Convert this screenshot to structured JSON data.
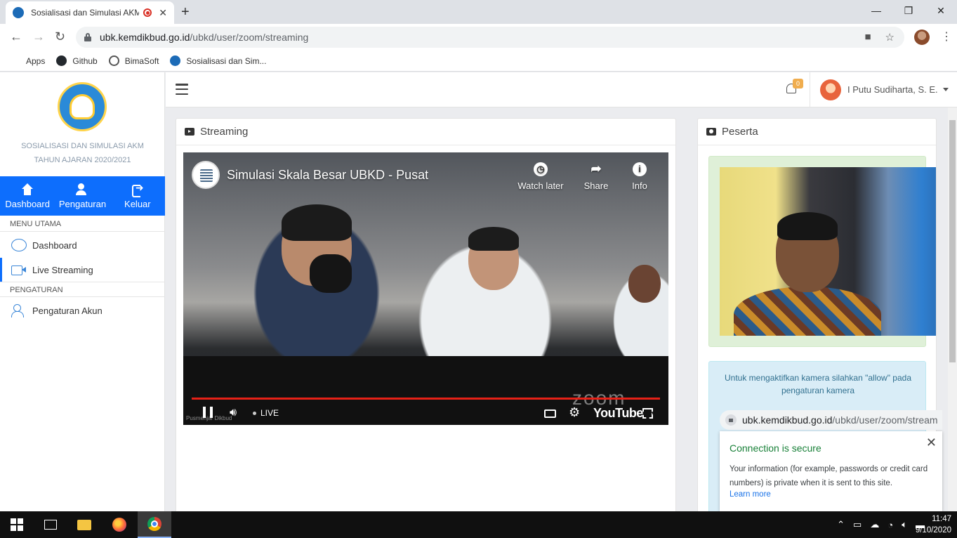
{
  "browser": {
    "tab_title": "Sosialisasi dan Simulasi AKM",
    "tab_close": "✕",
    "new_tab": "+",
    "window_controls": [
      "—",
      "❐",
      "✕"
    ],
    "url_host": "ubk.kemdikbud.go.id",
    "url_path": "/ubkd/user/zoom/streaming",
    "bookmarks": [
      {
        "label": "Apps",
        "icon": "apps-grid-icon"
      },
      {
        "label": "Github",
        "icon": "github-icon"
      },
      {
        "label": "BimaSoft",
        "icon": "globe-icon"
      },
      {
        "label": "Sosialisasi dan Sim...",
        "icon": "kemdikbud-icon"
      }
    ]
  },
  "sidebar": {
    "brand_line1": "SOSIALISASI DAN SIMULASI AKM",
    "brand_line2": "TAHUN AJARAN 2020/2021",
    "menubar": [
      {
        "label": "Dashboard",
        "icon": "home-icon"
      },
      {
        "label": "Pengaturan",
        "icon": "users-cog-icon"
      },
      {
        "label": "Keluar",
        "icon": "sign-out-icon"
      }
    ],
    "section_main": "MENU UTAMA",
    "section_settings": "PENGATURAN",
    "items": [
      {
        "label": "Dashboard",
        "icon": "dashboard-icon"
      },
      {
        "label": "Live Streaming",
        "icon": "video-camera-icon",
        "active": true
      },
      {
        "label": "Pengaturan Akun",
        "icon": "user-settings-icon"
      }
    ]
  },
  "topnav": {
    "notif_count": "0",
    "user_name": "I Putu Sudiharta, S. E."
  },
  "streaming": {
    "card_title": "Streaming",
    "video_title": "Simulasi Skala Besar UBKD - Pusat",
    "actions": [
      {
        "label": "Watch later",
        "icon": "clock-icon"
      },
      {
        "label": "Share",
        "icon": "share-icon"
      },
      {
        "label": "Info",
        "icon": "info-icon"
      }
    ],
    "live_label": "LIVE",
    "youtube_label": "YouTube",
    "watermark": "zoom",
    "corner_text": "Pusmenjar Dikbud",
    "progress": 1.0
  },
  "peserta": {
    "card_title": "Peserta",
    "camera_note": "Untuk mengaktifkan kamera silahkan \"allow\" pada pengaturan kamera"
  },
  "security_popup": {
    "url_host": "ubk.kemdikbud.go.id",
    "url_path": "/ubkd/user/zoom/stream",
    "title": "Connection is secure",
    "text": "Your information (for example, passwords or credit card numbers) is private when it is sent to this site.",
    "link": "Learn more",
    "close": "✕"
  },
  "taskbar": {
    "time": "11:47",
    "date": "9/10/2020"
  },
  "colors": {
    "primary": "#0d6efd",
    "youtube_red": "#e62117",
    "secure_green": "#188038",
    "badge": "#f0ad4e"
  }
}
